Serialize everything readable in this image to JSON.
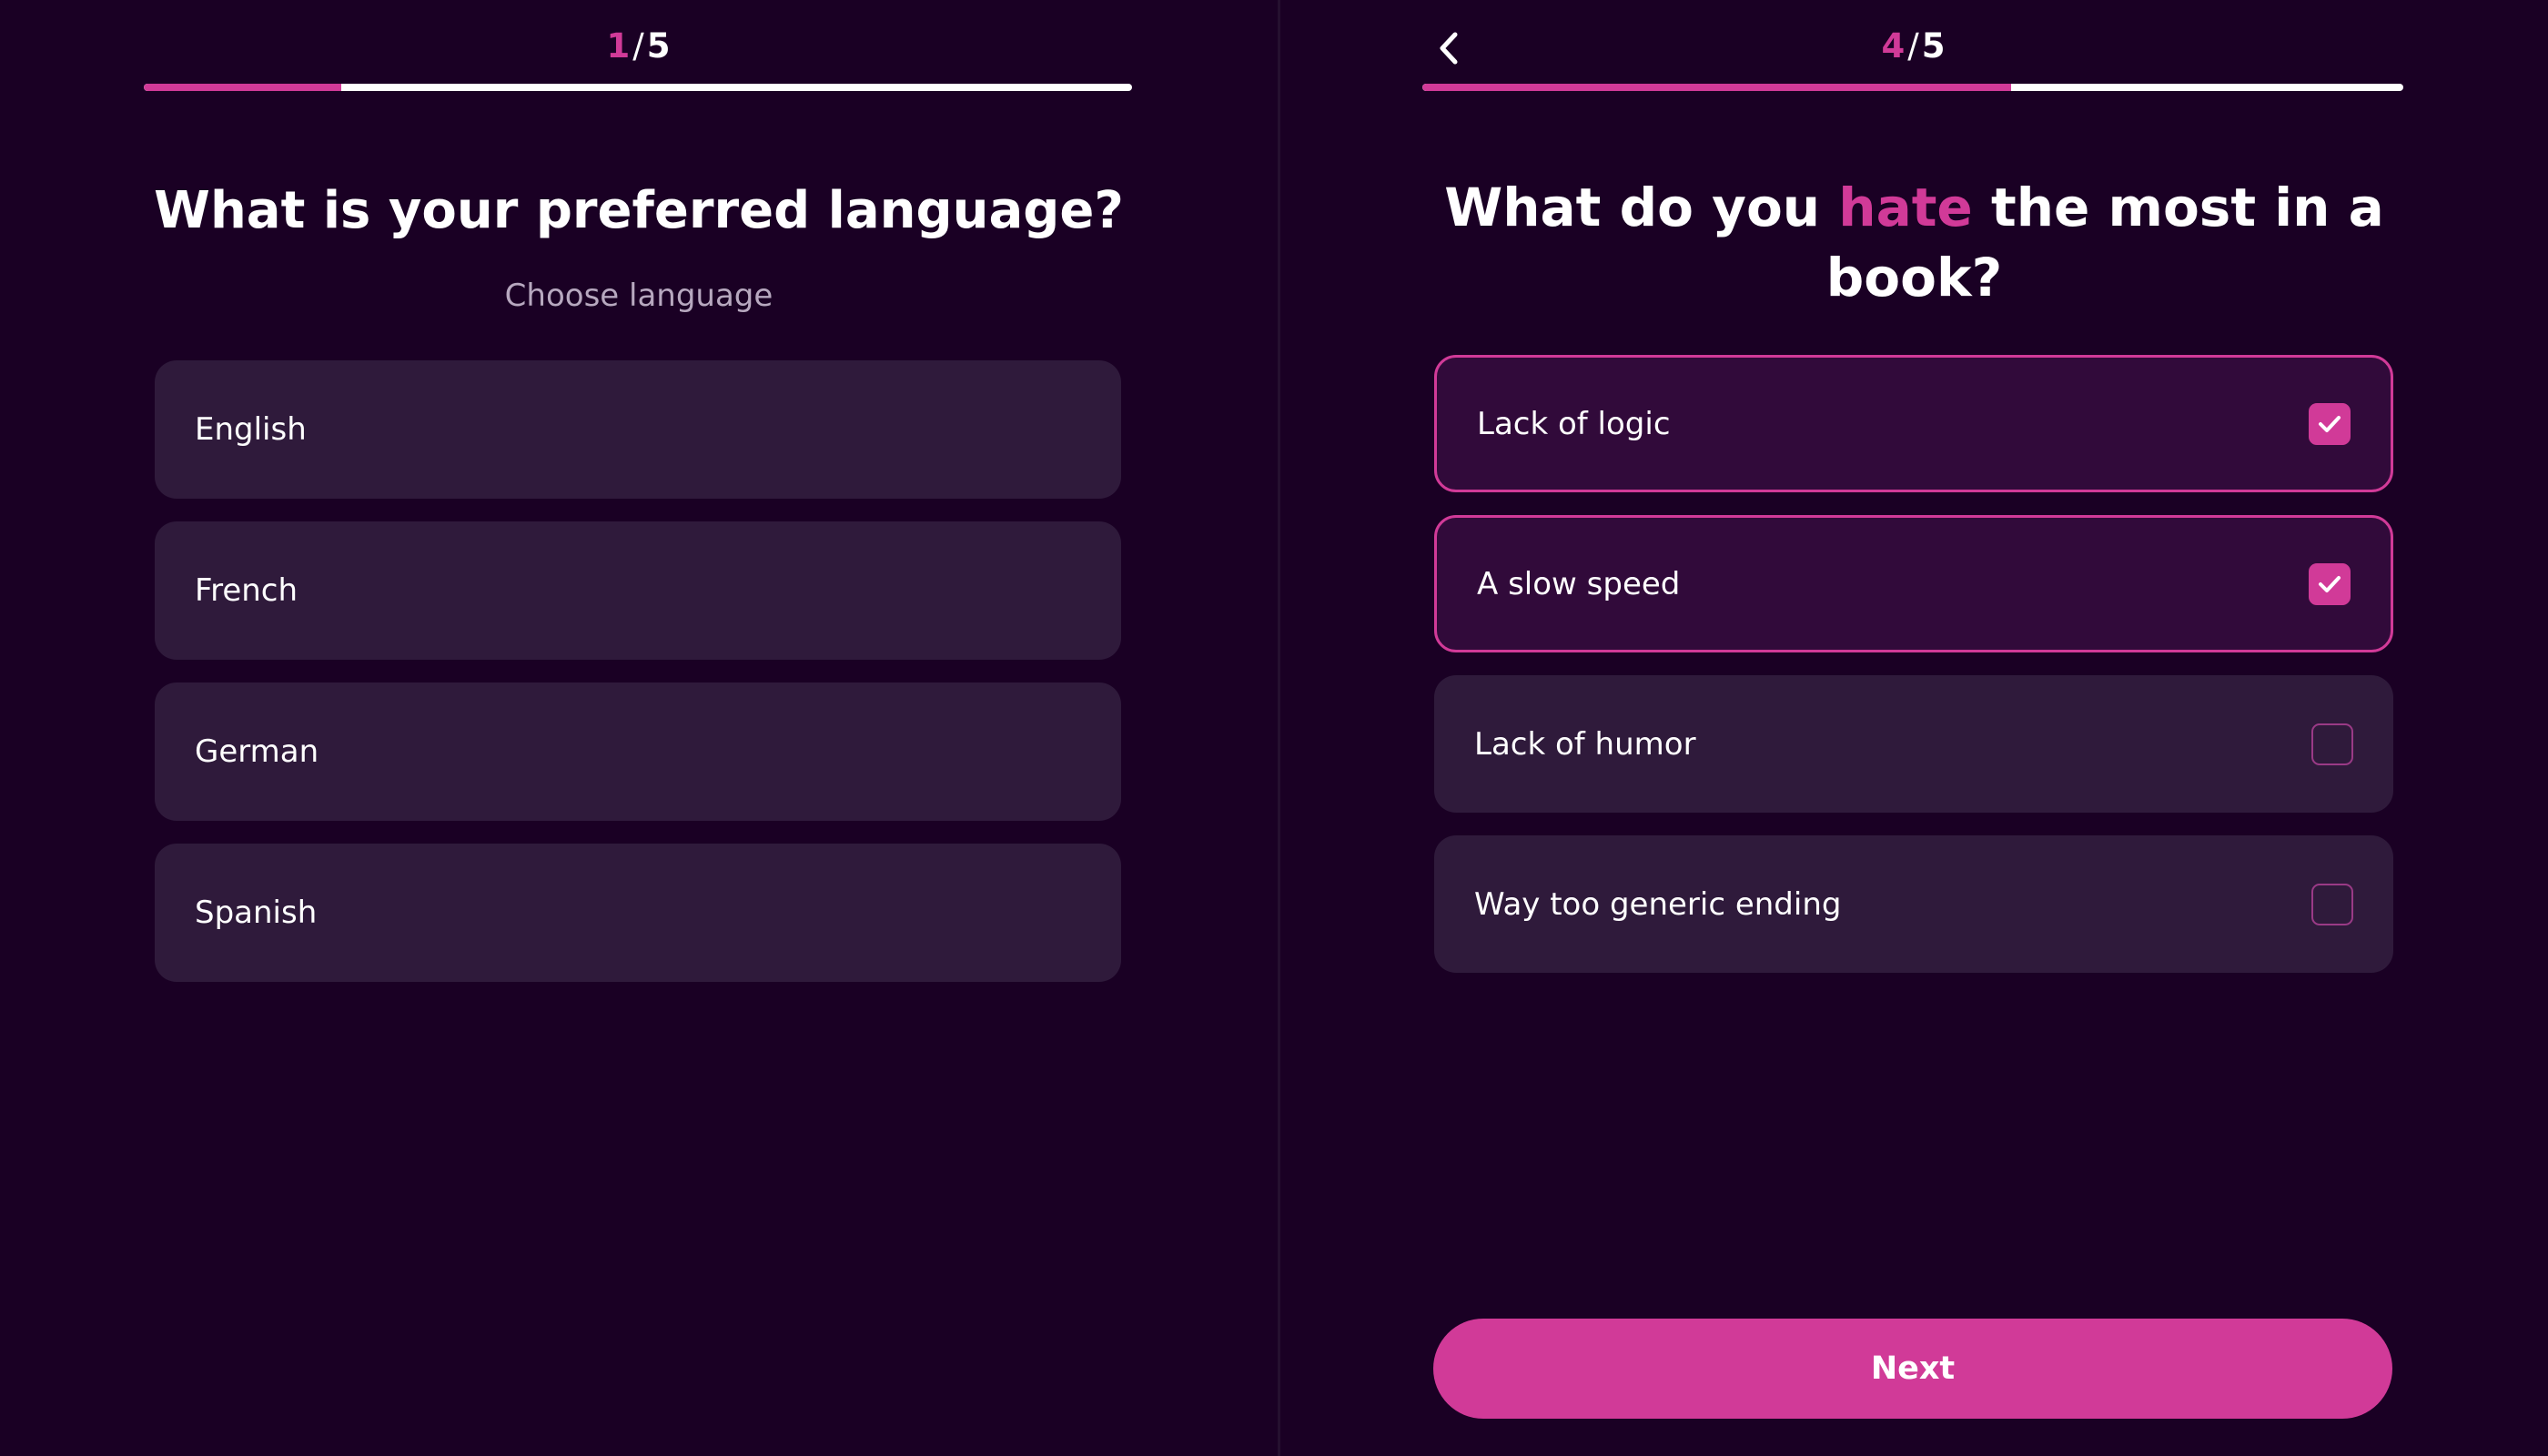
{
  "theme": {
    "accent": "#d13a98",
    "background": "#1a0024",
    "card": "#2f1a3b"
  },
  "left_screen": {
    "step": {
      "current": "1",
      "separator": "/",
      "total": "5"
    },
    "progress": 0.2,
    "question": "What is your preferred language?",
    "subtitle": "Choose language",
    "options": [
      {
        "label": "English"
      },
      {
        "label": "French"
      },
      {
        "label": "German"
      },
      {
        "label": "Spanish"
      }
    ]
  },
  "right_screen": {
    "back_icon": "chevron-left-icon",
    "step": {
      "current": "4",
      "separator": "/",
      "total": "5"
    },
    "progress": 0.6,
    "question": {
      "before": "What do you ",
      "highlight": "hate",
      "after": " the most in a book?"
    },
    "options": [
      {
        "label": "Lack of logic",
        "checked": true
      },
      {
        "label": "A slow speed",
        "checked": true
      },
      {
        "label": "Lack of humor",
        "checked": false
      },
      {
        "label": "Way too generic ending",
        "checked": false
      }
    ],
    "next_label": "Next"
  }
}
